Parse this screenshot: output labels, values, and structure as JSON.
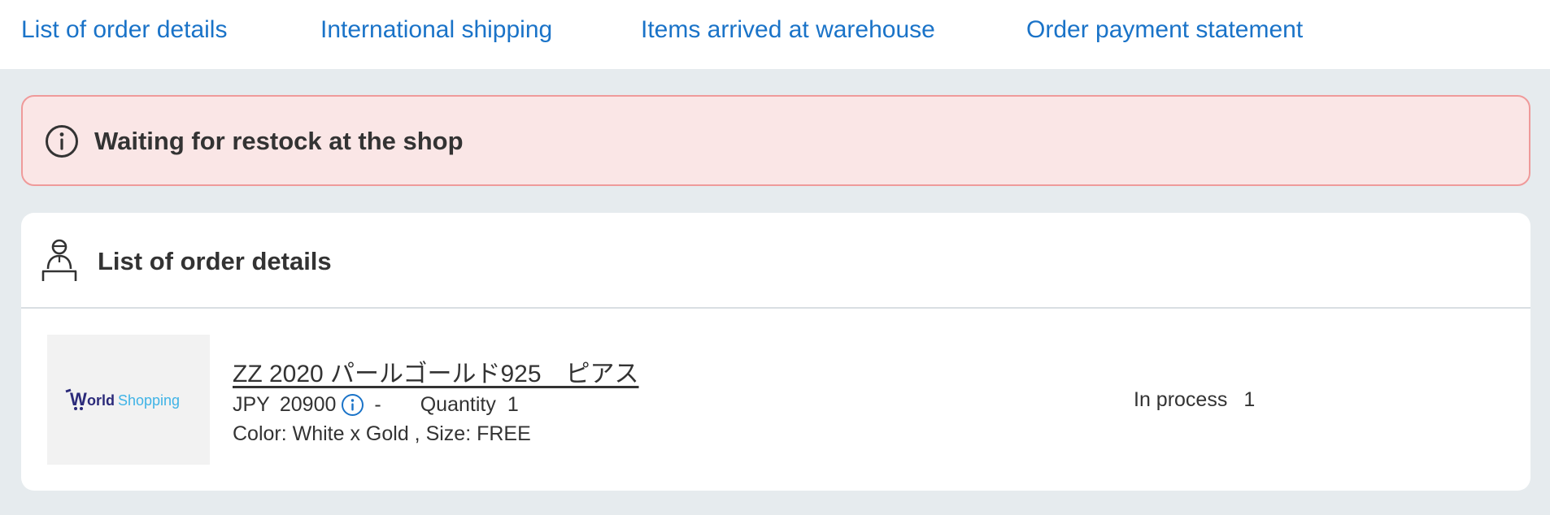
{
  "nav": {
    "items": [
      {
        "label": "List of order details"
      },
      {
        "label": "International shipping"
      },
      {
        "label": "Items arrived at warehouse"
      },
      {
        "label": "Order payment statement"
      }
    ],
    "link_color": "#1a73c8"
  },
  "alert": {
    "icon": "info-circle-icon",
    "message": "Waiting for restock at the shop",
    "background": "#fae6e6",
    "border": "#ef9a9a"
  },
  "order_card": {
    "icon": "person-at-counter-icon",
    "title": "List of order details",
    "items": [
      {
        "thumbnail_logo": "WorldShopping",
        "name": "ZZ 2020 パールゴールド925　ピアス",
        "currency": "JPY",
        "price": "20900",
        "price_info_icon": "info-circle-icon",
        "dash": "-",
        "quantity_label": "Quantity",
        "quantity": "1",
        "variant": "Color: White x Gold , Size: FREE",
        "status_label": "In process",
        "status_count": "1"
      }
    ]
  }
}
